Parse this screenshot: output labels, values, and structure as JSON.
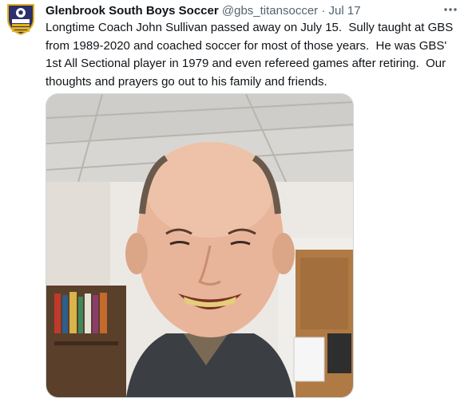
{
  "tweet": {
    "author": {
      "display_name": "Glenbrook South Boys Soccer",
      "handle": "@gbs_titansoccer",
      "avatar_icon": "titan-soccer-crest-icon"
    },
    "separator": "·",
    "date": "Jul 17",
    "more_icon": "more-horizontal-icon",
    "text": "Longtime Coach John Sullivan passed away on July 15.  Sully taught at GBS from 1989-2020 and coached soccer for most of those years.  He was GBS' 1st All Sectional player in 1979 and even refereed games after retiring.  Our thoughts and prayers go out to his family and friends.",
    "colors": {
      "crest_navy": "#2b2f6b",
      "crest_gold": "#e5b21b",
      "text_primary": "#0f1419",
      "text_secondary": "#536471"
    }
  }
}
